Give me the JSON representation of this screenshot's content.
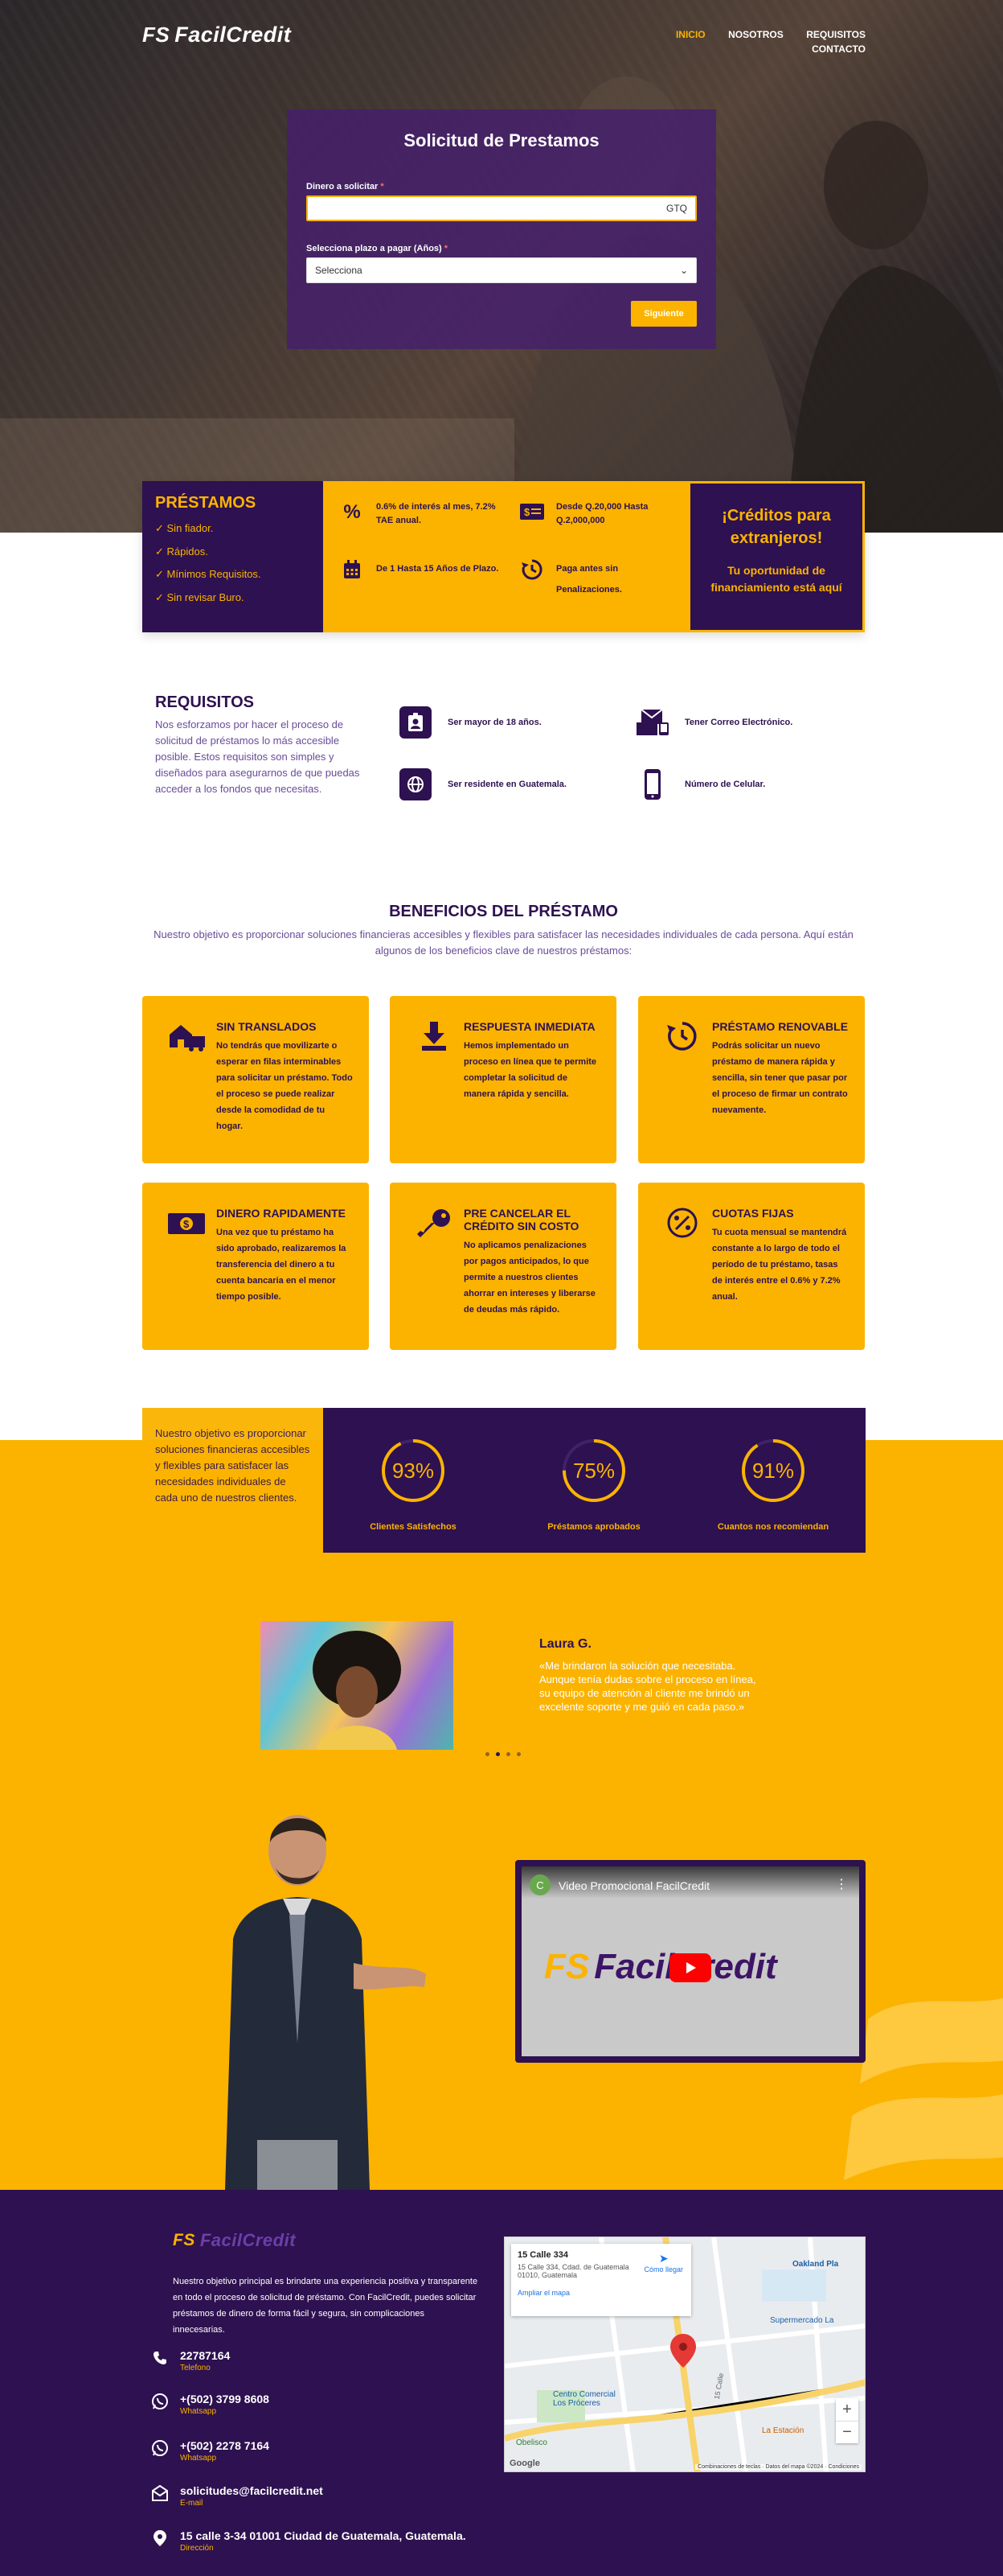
{
  "header": {
    "logo_text": "FacilCredit",
    "logo_mark": "FS",
    "nav": [
      "INICIO",
      "NOSOTROS",
      "REQUISITOS",
      "CONTACTO"
    ],
    "nav_active_index": 0
  },
  "loan_form": {
    "title": "Solicitud de Prestamos",
    "amount_label": "Dinero a solicitar",
    "amount_required_mark": "*",
    "amount_currency": "GTQ",
    "term_label": "Selecciona plazo a pagar (Años)",
    "term_required_mark": "*",
    "term_selected": "Selecciona",
    "submit_label": "Siguiente"
  },
  "features_bar": {
    "title": "PRÉSTAMOS",
    "checks": [
      "✓ Sin fiador.",
      "✓ Rápidos.",
      "✓ Mínimos Requisitos.",
      "✓ Sin revisar Buro."
    ],
    "items": [
      {
        "icon": "percent-icon",
        "text": "0.6% de interés al mes, 7.2% TAE anual."
      },
      {
        "icon": "money-icon",
        "text": "Desde Q.20,000 Hasta Q.2,000,000"
      },
      {
        "icon": "calendar-icon",
        "text": "De 1 Hasta 15 Años de Plazo."
      },
      {
        "icon": "history-icon",
        "text": "Paga antes sin Penalizaciones."
      }
    ],
    "foreign_title": "¡Créditos para extranjeros!",
    "foreign_subtitle": "Tu oportunidad de financiamiento está aquí"
  },
  "requirements": {
    "title": "REQUISITOS",
    "description": "Nos esforzamos por hacer el proceso de solicitud de préstamos lo más accesible posible. Estos requisitos son simples y diseñados para asegurarnos de que puedas acceder a los fondos que necesitas.",
    "items": [
      {
        "icon": "id-badge-icon",
        "text": "Ser mayor de 18 años."
      },
      {
        "icon": "email-icon",
        "text": "Tener Correo Electrónico."
      },
      {
        "icon": "passport-icon",
        "text": "Ser residente en Guatemala."
      },
      {
        "icon": "phone-icon",
        "text": "Número de Celular."
      }
    ]
  },
  "benefits": {
    "title": "BENEFICIOS DEL PRÉSTAMO",
    "subtitle": "Nuestro objetivo es proporcionar soluciones financieras accesibles y flexibles para satisfacer las necesidades individuales de cada persona. Aquí están algunos de los beneficios clave de nuestros préstamos:",
    "cards": [
      {
        "icon": "house-truck-icon",
        "title": "SIN TRANSLADOS",
        "text": "No tendrás que movilizarte o esperar en filas interminables para solicitar un préstamo. Todo el proceso se puede realizar desde la comodidad de tu hogar."
      },
      {
        "icon": "download-icon",
        "title": "RESPUESTA INMEDIATA",
        "text": "Hemos implementado un proceso en línea que te permite completar la solicitud de manera rápida y sencilla."
      },
      {
        "icon": "clock-renew-icon",
        "title": "PRÉSTAMO RENOVABLE",
        "text": "Podrás solicitar un nuevo préstamo de manera rápida y sencilla, sin tener que pasar por el proceso de firmar un contrato nuevamente."
      },
      {
        "icon": "money-bill-icon",
        "title": "DINERO RAPIDAMENTE",
        "text": "Una vez que tu préstamo ha sido aprobado, realizaremos la transferencia del dinero a tu cuenta bancaria en el menor tiempo posible."
      },
      {
        "icon": "key-icon",
        "title": "PRE CANCELAR EL CRÉDITO SIN COSTO",
        "text": "No aplicamos penalizaciones por pagos anticipados, lo que permite a nuestros clientes ahorrar en intereses y liberarse de deudas más rápido."
      },
      {
        "icon": "percent-circle-icon",
        "title": "CUOTAS FIJAS",
        "text": "Tu cuota mensual se mantendrá constante a lo largo de todo el período de tu préstamo, tasas de interés entre el 0.6% y 7.2% anual."
      }
    ]
  },
  "stats": {
    "intro": "Nuestro objetivo es proporcionar soluciones financieras accesibles y flexibles para satisfacer las necesidades individuales de cada uno de nuestros clientes.",
    "items": [
      {
        "value": "93%",
        "fraction": 0.93,
        "label": "Clientes Satisfechos"
      },
      {
        "value": "75%",
        "fraction": 0.75,
        "label": "Préstamos aprobados"
      },
      {
        "value": "91%",
        "fraction": 0.91,
        "label": "Cuantos nos recomiendan"
      }
    ]
  },
  "testimonial": {
    "name": "Laura G.",
    "quote": "«Me brindaron la solución que necesitaba. Aunque tenía dudas sobre el proceso en línea, su equipo de atención al cliente me brindó un excelente soporte y me guió en cada paso.»",
    "dots": 4,
    "active_dot": 1
  },
  "video": {
    "channel_initial": "C",
    "title": "Video Promocional FacilCredit",
    "logo_text": "FacilCredit",
    "logo_mark": "FS"
  },
  "footer": {
    "logo_text": "FacilCredit",
    "logo_mark": "FS",
    "description": "Nuestro objetivo principal es brindarte una experiencia positiva y transparente en todo el proceso de solicitud de préstamo. Con FacilCredit, puedes solicitar préstamos de dinero de forma fácil y segura, sin complicaciones innecesarias.",
    "contacts": [
      {
        "icon": "phone-icon",
        "value": "22787164",
        "label": "Telefono"
      },
      {
        "icon": "whatsapp-icon",
        "value": "+(502) 3799 8608",
        "label": "Whatsapp"
      },
      {
        "icon": "whatsapp-icon",
        "value": "+(502) 2278 7164",
        "label": "Whatsapp"
      },
      {
        "icon": "envelope-icon",
        "value": "solicitudes@facilcredit.net",
        "label": "E-mail"
      },
      {
        "icon": "location-icon",
        "value": "15 calle 3-34 01001 Ciudad de Guatemala, Guatemala.",
        "label": "Dirección"
      }
    ],
    "map": {
      "place": "15 Calle 334",
      "address": "15 Calle 334, Cdad. de Guatemala 01010, Guatemala",
      "directions": "Cómo llegar",
      "enlarge": "Ampliar el mapa",
      "labels": [
        "Oakland Pla",
        "Supermercado La",
        "Centro Comercial Los Próceres",
        "La Estación",
        "Obelisco",
        "15 Calle",
        "Google"
      ],
      "attribution": "Combinaciones de teclas · Datos del mapa ©2024 · Condiciones"
    }
  }
}
